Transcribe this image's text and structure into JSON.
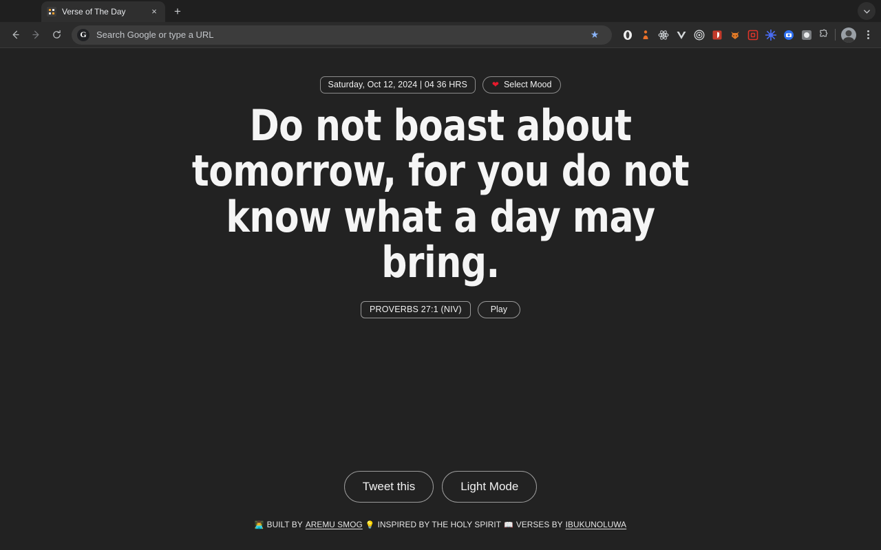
{
  "browser": {
    "tab": {
      "title": "Verse of The Day",
      "favicon_name": "verse-favicon",
      "close_label": "×"
    },
    "new_tab_label": "+",
    "tab_search_label": "⌄",
    "nav": {
      "back_label": "←",
      "forward_label": "→",
      "reload_label": "⟳"
    },
    "omnibox": {
      "placeholder": "Search Google or type a URL",
      "value": "Search Google or type a URL",
      "google_logo_label": "G",
      "bookmark_label": "★"
    },
    "extensions": [
      {
        "name": "opera-extension-icon",
        "glyph": "◉",
        "color": "#f2f2f2"
      },
      {
        "name": "person-extension-icon",
        "glyph": "♟",
        "color": "#e8702a"
      },
      {
        "name": "react-devtools-icon",
        "glyph": "⚛",
        "color": "#cfd3d6"
      },
      {
        "name": "vue-devtools-icon",
        "glyph": "▼",
        "color": "#d5d8da"
      },
      {
        "name": "target-extension-icon",
        "glyph": "◎",
        "color": "#d5d8da"
      },
      {
        "name": "bitwarden-extension-icon",
        "glyph": "■",
        "color": "#c23a2b"
      },
      {
        "name": "fox-extension-icon",
        "glyph": "◆",
        "color": "#e07a28"
      },
      {
        "name": "red-square-extension-icon",
        "glyph": "▣",
        "color": "#e0342a"
      },
      {
        "name": "gear-extension-icon",
        "glyph": "✳",
        "color": "#4a6df5"
      },
      {
        "name": "blue-badge-extension-icon",
        "glyph": "●",
        "color": "#2d6ff0"
      },
      {
        "name": "gray-circle-extension-icon",
        "glyph": "●",
        "color": "#b9bcbf"
      }
    ],
    "puzzle_label": "⬚",
    "profile_name": "avatar",
    "menu_name": "chrome-menu"
  },
  "page": {
    "datetime_badge": "Saturday, Oct 12, 2024 | 04   36 HRS",
    "mood_badge": {
      "emoji": "❤",
      "label": "Select Mood"
    },
    "verse_text": "Do not boast about tomorrow, for you do not know what a day may bring.",
    "reference": "PROVERBS 27:1 (NIV)",
    "play_label": "Play",
    "actions": {
      "tweet_label": "Tweet this",
      "theme_label": "Light Mode"
    },
    "footer": {
      "built_emoji": "👨‍💻",
      "built_by_text": "BUILT BY",
      "built_by_name": "AREMU SMOG",
      "inspired_emoji": "💡",
      "inspired_text": "INSPIRED BY THE HOLY SPIRIT",
      "verses_emoji": "📖",
      "verses_text": "VERSES BY",
      "verses_by_name": "IBUKUNOLUWA"
    }
  },
  "colors": {
    "page_bg": "#222222",
    "tabstrip_bg": "#1f1f1f",
    "toolbar_bg": "#2b2b2b",
    "text": "#f5f5f5",
    "heart_red": "#e8192c",
    "border": "#9a9a9a"
  }
}
